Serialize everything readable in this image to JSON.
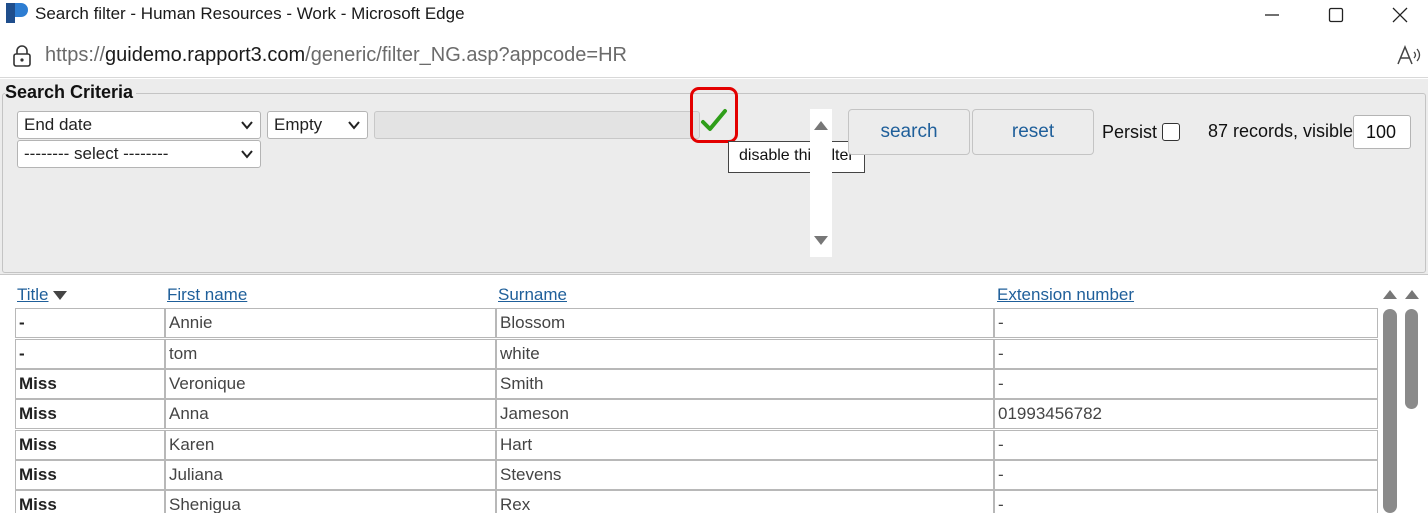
{
  "window": {
    "title": "Search filter - Human Resources - Work - Microsoft Edge",
    "minimize_icon": "minimize-icon",
    "maximize_icon": "maximize-icon",
    "close_icon": "close-icon"
  },
  "address": {
    "prefix": "https://",
    "domain": "guidemo.rapport3.com",
    "path": "/generic/filter_NG.asp?appcode=HR"
  },
  "criteria": {
    "legend": "Search Criteria",
    "field_select": "End date",
    "operator_select": "Empty",
    "filter_select": "-------- select --------",
    "value_input": "",
    "tooltip": "disable this filter",
    "search_button": "search",
    "reset_button": "reset",
    "persist_label": "Persist",
    "persist_checked": false,
    "records_label": "87 records, visible:",
    "visible_value": "100",
    "check_color": "#2f9e1a",
    "highlight_color": "#e30000"
  },
  "table": {
    "headers": [
      "Title",
      "First name",
      "Surname",
      "Extension number"
    ],
    "sort_column": "Title",
    "rows": [
      [
        "-",
        "Annie",
        "Blossom",
        "-"
      ],
      [
        "-",
        "tom",
        "white",
        "-"
      ],
      [
        "Miss",
        "Veronique",
        "Smith",
        "-"
      ],
      [
        "Miss",
        "Anna",
        "Jameson",
        "01993456782"
      ],
      [
        "Miss",
        "Karen",
        "Hart",
        "-"
      ],
      [
        "Miss",
        "Juliana",
        "Stevens",
        "-"
      ],
      [
        "Miss",
        "Shenigua",
        "Rex",
        "-"
      ]
    ]
  },
  "colors": {
    "link": "#1f5f9a",
    "panel_bg": "#ececec"
  }
}
